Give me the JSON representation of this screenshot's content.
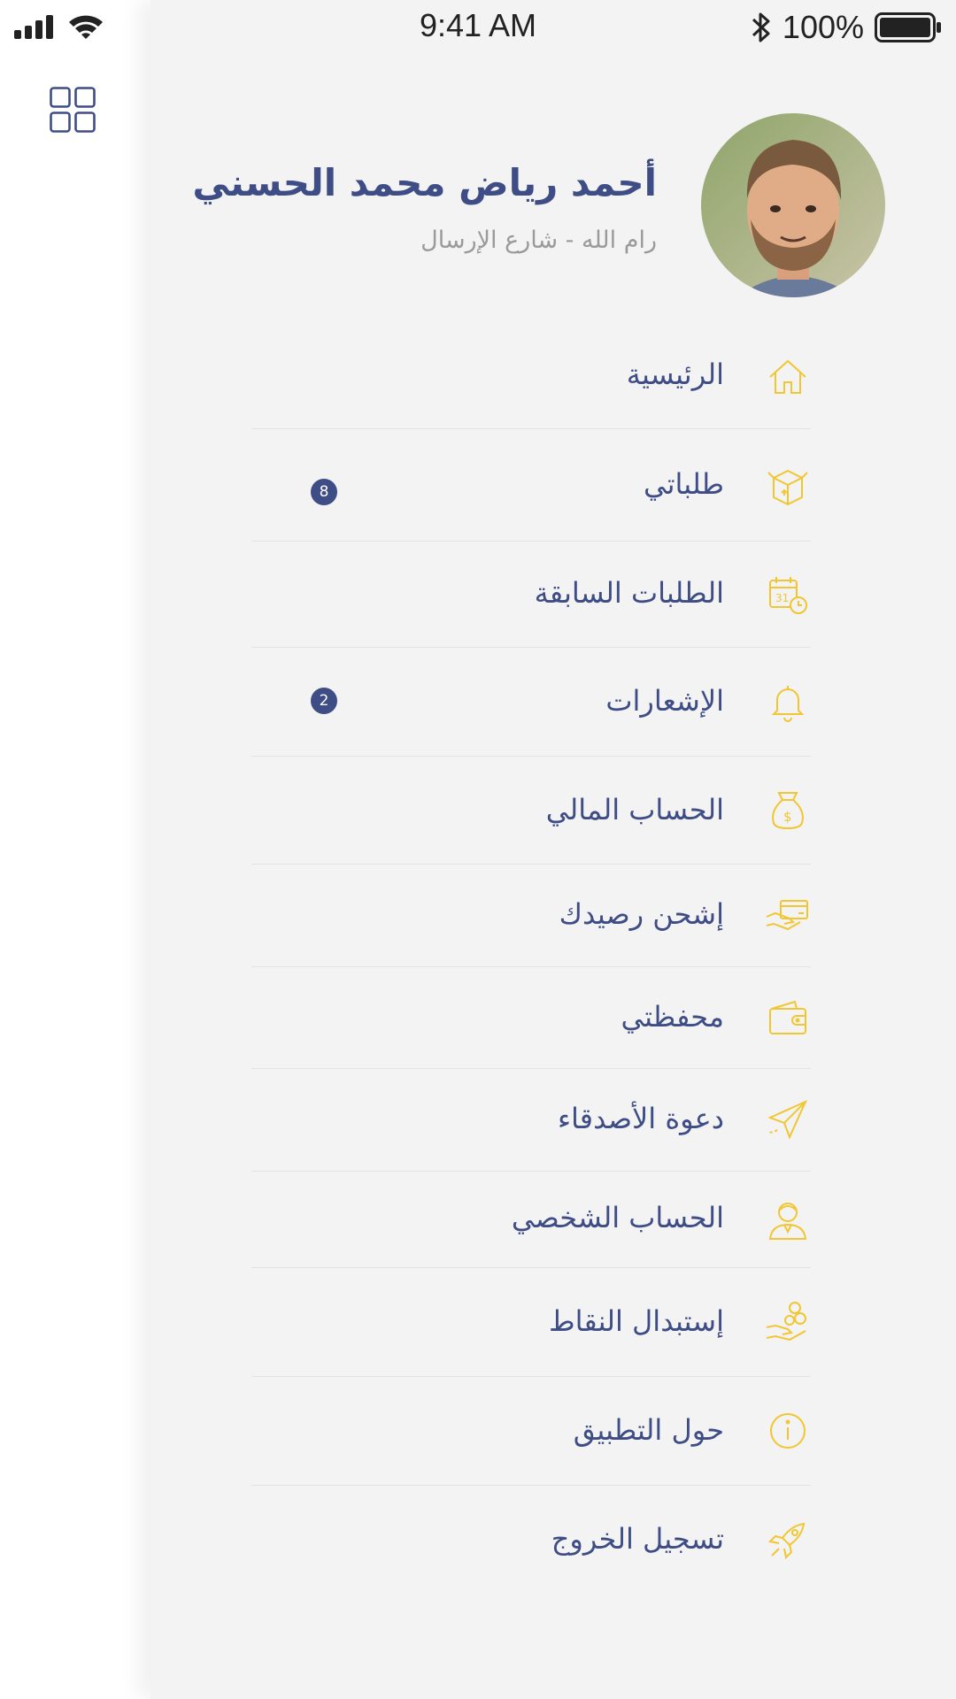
{
  "status_bar": {
    "time": "9:41 AM",
    "battery": "100%"
  },
  "user": {
    "name": "أحمد رياض محمد الحسني",
    "location": "رام الله - شارع الإرسال"
  },
  "menu": {
    "items": [
      {
        "label": "الرئيسية",
        "icon": "home-icon"
      },
      {
        "label": "طلباتي",
        "icon": "box-icon",
        "badge": "8"
      },
      {
        "label": "الطلبات السابقة",
        "icon": "calendar-clock-icon"
      },
      {
        "label": "الإشعارات",
        "icon": "bell-icon",
        "badge": "2"
      },
      {
        "label": "الحساب المالي",
        "icon": "money-bag-icon"
      },
      {
        "label": "إشحن رصيدك",
        "icon": "card-hand-icon"
      },
      {
        "label": "محفظتي",
        "icon": "wallet-icon"
      },
      {
        "label": "دعوة الأصدقاء",
        "icon": "paper-plane-icon"
      },
      {
        "label": "الحساب الشخصي",
        "icon": "user-icon"
      },
      {
        "label": "إستبدال النقاط",
        "icon": "coins-hand-icon"
      },
      {
        "label": "حول التطبيق",
        "icon": "info-icon"
      },
      {
        "label": "تسجيل الخروج",
        "icon": "rocket-icon"
      }
    ]
  },
  "colors": {
    "accent": "#f2c630",
    "primary": "#3e4d85",
    "panel_bg": "#f3f3f3"
  }
}
